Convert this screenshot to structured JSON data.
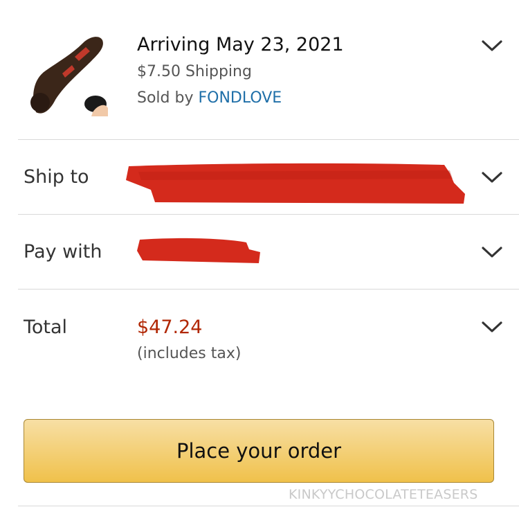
{
  "item": {
    "arriving": "Arriving May 23, 2021",
    "shipping": "$7.50 Shipping",
    "sold_by_prefix": "Sold by ",
    "seller": "FONDLOVE"
  },
  "ship_to": {
    "label": "Ship to"
  },
  "pay_with": {
    "label": "Pay with"
  },
  "total": {
    "label": "Total",
    "amount": "$47.24",
    "tax_note": "(includes tax)"
  },
  "actions": {
    "place_order": "Place your order"
  },
  "watermark": "KINKYYCHOCOLATETEASERS",
  "colors": {
    "price": "#b12704",
    "seller_link": "#1f6fa8",
    "button_top": "#f7dfa5",
    "button_bottom": "#f0c14b",
    "redaction": "#d42a1c"
  },
  "icons": {
    "expand": "chevron-down-icon",
    "product": "product-thumbnail"
  }
}
